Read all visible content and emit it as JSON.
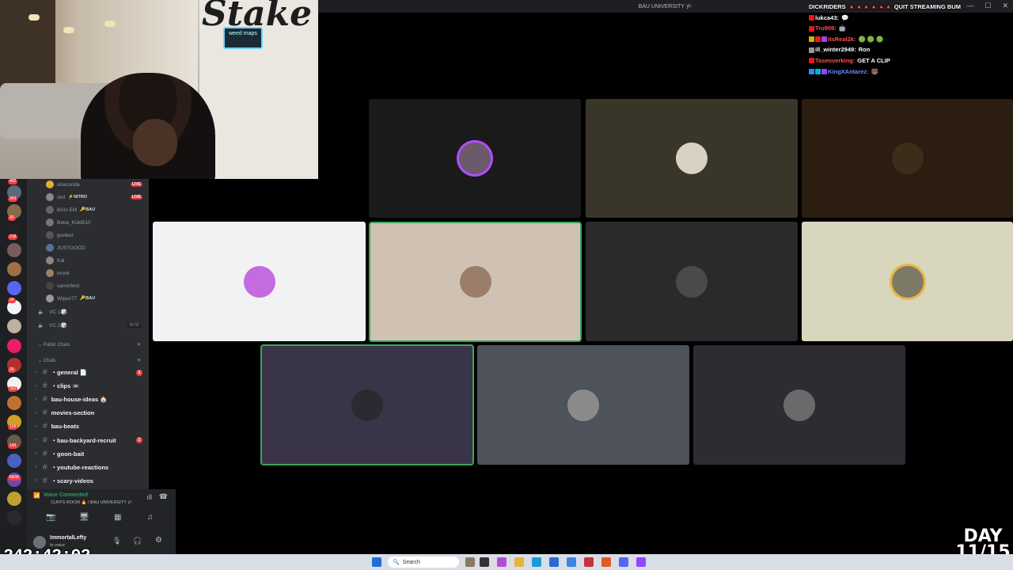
{
  "titlebar": {
    "title": "BAU UNIVERSITY 🎓",
    "controls": [
      "—",
      "☐",
      "✕"
    ]
  },
  "webcam": {
    "brand": "Stake",
    "neon": "weed maps"
  },
  "chat": [
    {
      "user": "DICKRIDERS",
      "user_color": "#ffffff",
      "msg": "🔺🔺🔺🔺🔺🔺 QUIT STREAMING BUM",
      "badges": []
    },
    {
      "user": "lukca43:",
      "user_color": "#ffffff",
      "msg": "💬",
      "badges": [
        "#e91916"
      ]
    },
    {
      "user": "Tru909:",
      "user_color": "#ff4f4f",
      "msg": "🤖",
      "badges": [
        "#e91916"
      ]
    },
    {
      "user": "itsReal2k:",
      "user_color": "#ff4f4f",
      "msg": "🟢 🟢 🟢",
      "badges": [
        "#e0b000",
        "#e91916",
        "#9147ff"
      ]
    },
    {
      "user": "ill_winter2949:",
      "user_color": "#ffffff",
      "msg": "Ron",
      "badges": [
        "#9a9a9a"
      ]
    },
    {
      "user": "Taseoverking:",
      "user_color": "#ff4f4f",
      "msg": "GET A CLIP",
      "badges": [
        "#e91916"
      ]
    },
    {
      "user": "KingXAntarez:",
      "user_color": "#6b8cff",
      "msg": "🐻",
      "badges": [
        "#1e90ff",
        "#00b4d8",
        "#9147ff"
      ]
    }
  ],
  "rail_counts": [
    "442",
    "343",
    "90",
    "218",
    "34",
    "26",
    "302",
    "109",
    "143",
    "NEW"
  ],
  "voice_users": [
    {
      "name": "anaconda",
      "tag": "",
      "live": true
    },
    {
      "name": "skrl",
      "tag": "⚡NITRO",
      "live": true
    },
    {
      "name": "BAU-EM",
      "tag": "🔑BAU",
      "live": false
    },
    {
      "name": "Bebe_Kidd510",
      "tag": "",
      "live": false
    },
    {
      "name": "gunkez",
      "tag": "",
      "live": false
    },
    {
      "name": "JUSTGOOD",
      "tag": "",
      "live": false
    },
    {
      "name": "Kal",
      "tag": "",
      "live": false
    },
    {
      "name": "monk",
      "tag": "",
      "live": false
    },
    {
      "name": "sarvinfent",
      "tag": "",
      "live": false
    },
    {
      "name": "Wipez77",
      "tag": "🔑BAU",
      "live": false
    }
  ],
  "live_label": "LIVE",
  "voice_channels": [
    {
      "name": "VC 1🎲",
      "count": ""
    },
    {
      "name": "VC 2🎲",
      "count": "00 50"
    }
  ],
  "categories": {
    "public": "Public Chats",
    "chats": "Chats"
  },
  "channels": [
    {
      "name": "・general 📄",
      "ping": "2"
    },
    {
      "name": "・clips 📼",
      "ping": ""
    },
    {
      "name": "bau-house-ideas 🏠",
      "ping": ""
    },
    {
      "name": "movies-section",
      "ping": ""
    },
    {
      "name": "bau-beats",
      "ping": ""
    },
    {
      "name": "・bau-backyard-recruit",
      "ping": "2"
    },
    {
      "name": "・goon-bait",
      "ping": ""
    },
    {
      "name": "・youtube-reactions",
      "ping": ""
    },
    {
      "name": "・scary-videos",
      "ping": ""
    }
  ],
  "voice_panel": {
    "status": "Voice Connected",
    "room": "CUFFS ROOM 🔥 / BAU UNIVERSITY 🎓"
  },
  "user_panel": {
    "name": "ImmortalLefty",
    "status": "In voice"
  },
  "tiles": [
    {
      "bg": "#1a1a1a",
      "pfp": "#6a5a6a",
      "ring": "#b04dff",
      "speaking": false
    },
    {
      "bg": "#3a3529",
      "pfp": "#d8d2c2",
      "ring": "",
      "speaking": false
    },
    {
      "bg": "#2b1d10",
      "pfp": "#3a2e1a",
      "ring": "",
      "speaking": false
    },
    {
      "bg": "#f2f1f3",
      "pfp": "#c46be0",
      "ring": "",
      "speaking": false
    },
    {
      "bg": "#d0c2b2",
      "pfp": "#9a7e6a",
      "ring": "",
      "speaking": true
    },
    {
      "bg": "#2a292b",
      "pfp": "#4a4a4a",
      "ring": "",
      "speaking": false
    },
    {
      "bg": "#d8d6bc",
      "pfp": "#7e7a68",
      "ring": "#e8b840",
      "speaking": false
    },
    {
      "bg": "#3a3448",
      "pfp": "#2a2a30",
      "ring": "",
      "speaking": true
    },
    {
      "bg": "#4e525a",
      "pfp": "#8a8a8a",
      "ring": "",
      "speaking": false
    },
    {
      "bg": "#2e2c30",
      "pfp": "#6a6a6a",
      "ring": "",
      "speaking": false
    }
  ],
  "timer": "242:42:02",
  "day": {
    "label": "DAY",
    "value": "11/15"
  },
  "taskbar": {
    "search": "Search"
  }
}
